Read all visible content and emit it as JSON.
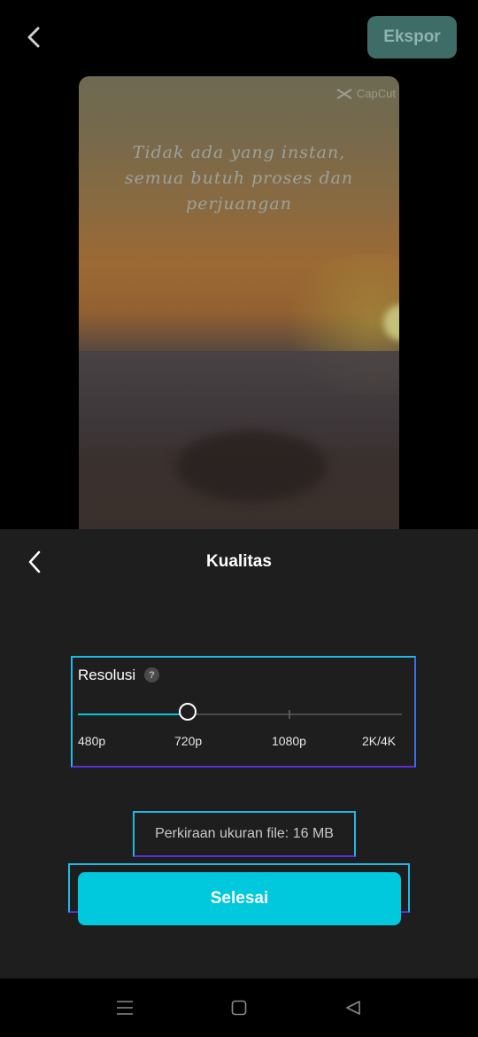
{
  "header": {
    "export_label": "Ekspor"
  },
  "preview": {
    "watermark": "CapCut",
    "quote": "Tidak ada yang instan, semua butuh proses dan perjuangan"
  },
  "sheet": {
    "title": "Kualitas",
    "resolution": {
      "label": "Resolusi",
      "help": "?",
      "options": [
        "480p",
        "720p",
        "1080p",
        "2K/4K"
      ],
      "selected": "720p"
    },
    "file_estimate": "Perkiraan ukuran file: 16 MB",
    "done_label": "Selesai"
  },
  "colors": {
    "accent": "#00c8dd",
    "export_bg": "#3e6d67",
    "sheet_bg": "#1e1e1e"
  }
}
